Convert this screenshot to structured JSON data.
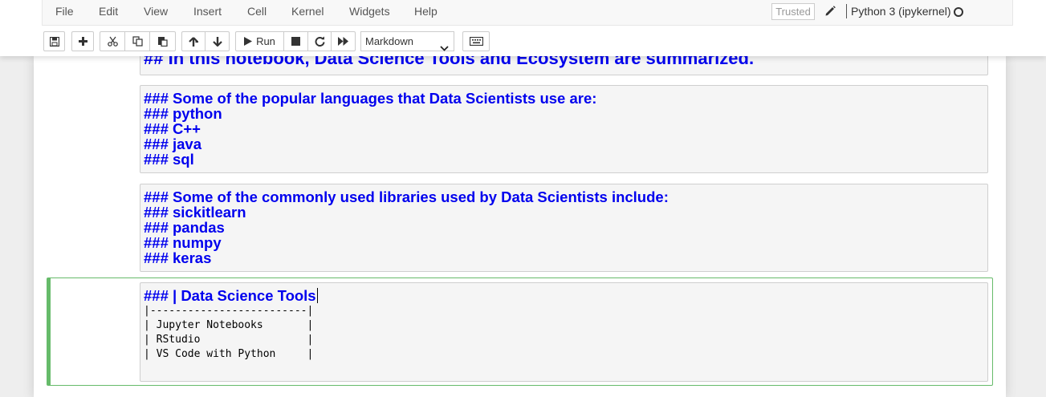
{
  "menu": {
    "items": [
      "File",
      "Edit",
      "View",
      "Insert",
      "Cell",
      "Kernel",
      "Widgets",
      "Help"
    ]
  },
  "header": {
    "trusted_label": "Trusted",
    "kernel_name": "Python 3 (ipykernel)",
    "kernel_status_icon": "circle-outline-icon"
  },
  "toolbar": {
    "run_label": "Run",
    "cell_type": "Markdown",
    "icons": [
      "save-icon",
      "plus-icon",
      "cut-icon",
      "copy-icon",
      "paste-icon",
      "arrow-up-icon",
      "arrow-down-icon",
      "play-icon",
      "stop-icon",
      "restart-icon",
      "fast-forward-icon",
      "keyboard-icon"
    ]
  },
  "cells": [
    {
      "lines": [
        "## In this notebook, Data Science Tools and Ecosystem are summarized."
      ]
    },
    {
      "lines": [
        "### Some of the popular languages that Data Scientists use are:",
        "### python",
        "### C++",
        "### java",
        "### sql"
      ]
    },
    {
      "lines": [
        "### Some of the commonly used libraries used by Data Scientists include:",
        "### sickitlearn",
        "### pandas",
        "### numpy",
        "### keras"
      ]
    },
    {
      "heading": "### | Data Science Tools",
      "code_lines": [
        "|-------------------------|",
        "| Jupyter Notebooks       |",
        "| RStudio                 |",
        "| VS Code with Python     |"
      ]
    }
  ],
  "colors": {
    "markdown_heading": "#0000ee",
    "selected_border": "#66bb6a",
    "cell_background": "#f5f5f5"
  }
}
